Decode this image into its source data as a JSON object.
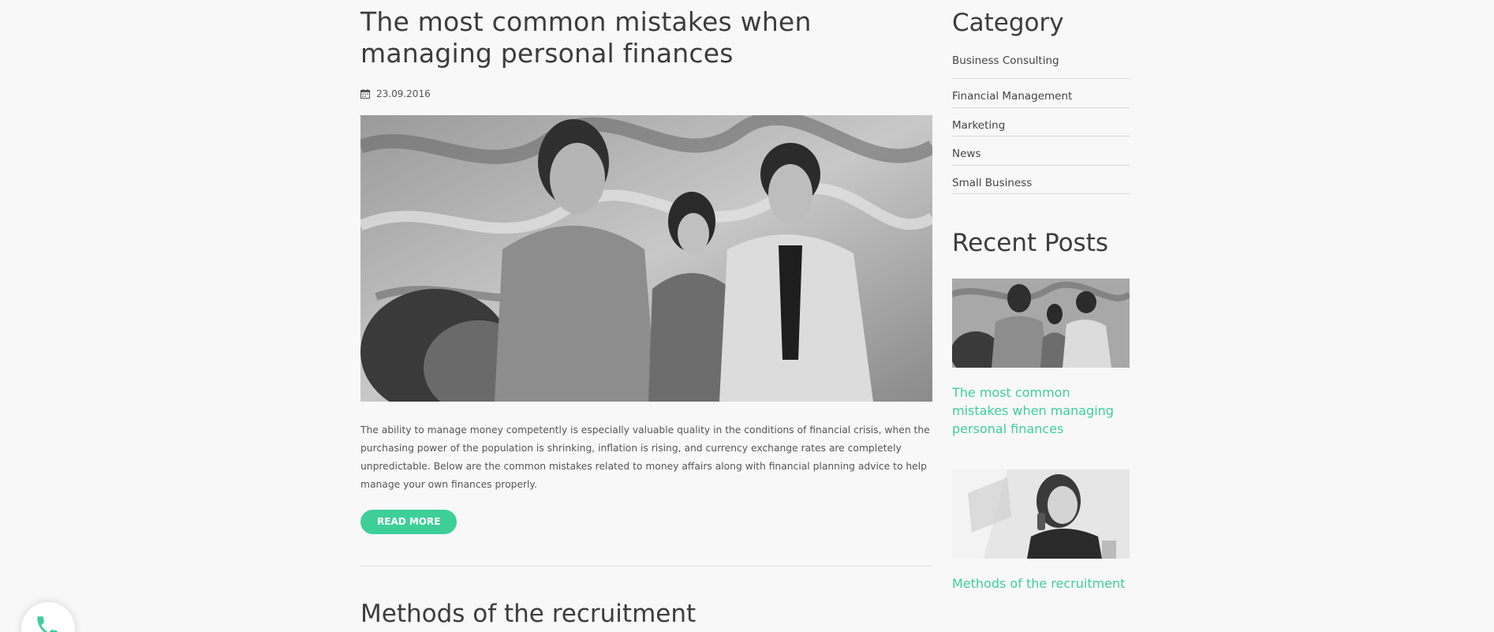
{
  "main": {
    "post": {
      "title": "The most common mistakes when managing personal finances",
      "date": "23.09.2016",
      "excerpt": "The ability to manage money competently is especially valuable quality in the conditions of financial crisis, when the purchasing power of the population is shrinking, inflation is rising, and currency exchange rates are completely unpredictable. Below are the common mistakes related to money affairs along with financial planning advice to help manage your own finances properly.",
      "read_more": "READ MORE",
      "image_icon": "photo-group-image"
    },
    "next_post": {
      "title": "Methods of the recruitment"
    }
  },
  "sidebar": {
    "category_title": "Category",
    "categories": [
      {
        "label": "Business Consulting"
      },
      {
        "label": "Financial Management"
      },
      {
        "label": "Marketing"
      },
      {
        "label": "News"
      },
      {
        "label": "Small Business"
      }
    ],
    "recent_title": "Recent Posts",
    "recent_posts": [
      {
        "title": "The most common mistakes when managing personal finances"
      },
      {
        "title": "Methods of the recruitment"
      }
    ]
  },
  "icons": {
    "calendar": "calendar-icon",
    "phone": "phone-icon"
  },
  "colors": {
    "accent": "#3ecf98",
    "background": "#f8f8f8",
    "text": "#3c3c3c"
  }
}
